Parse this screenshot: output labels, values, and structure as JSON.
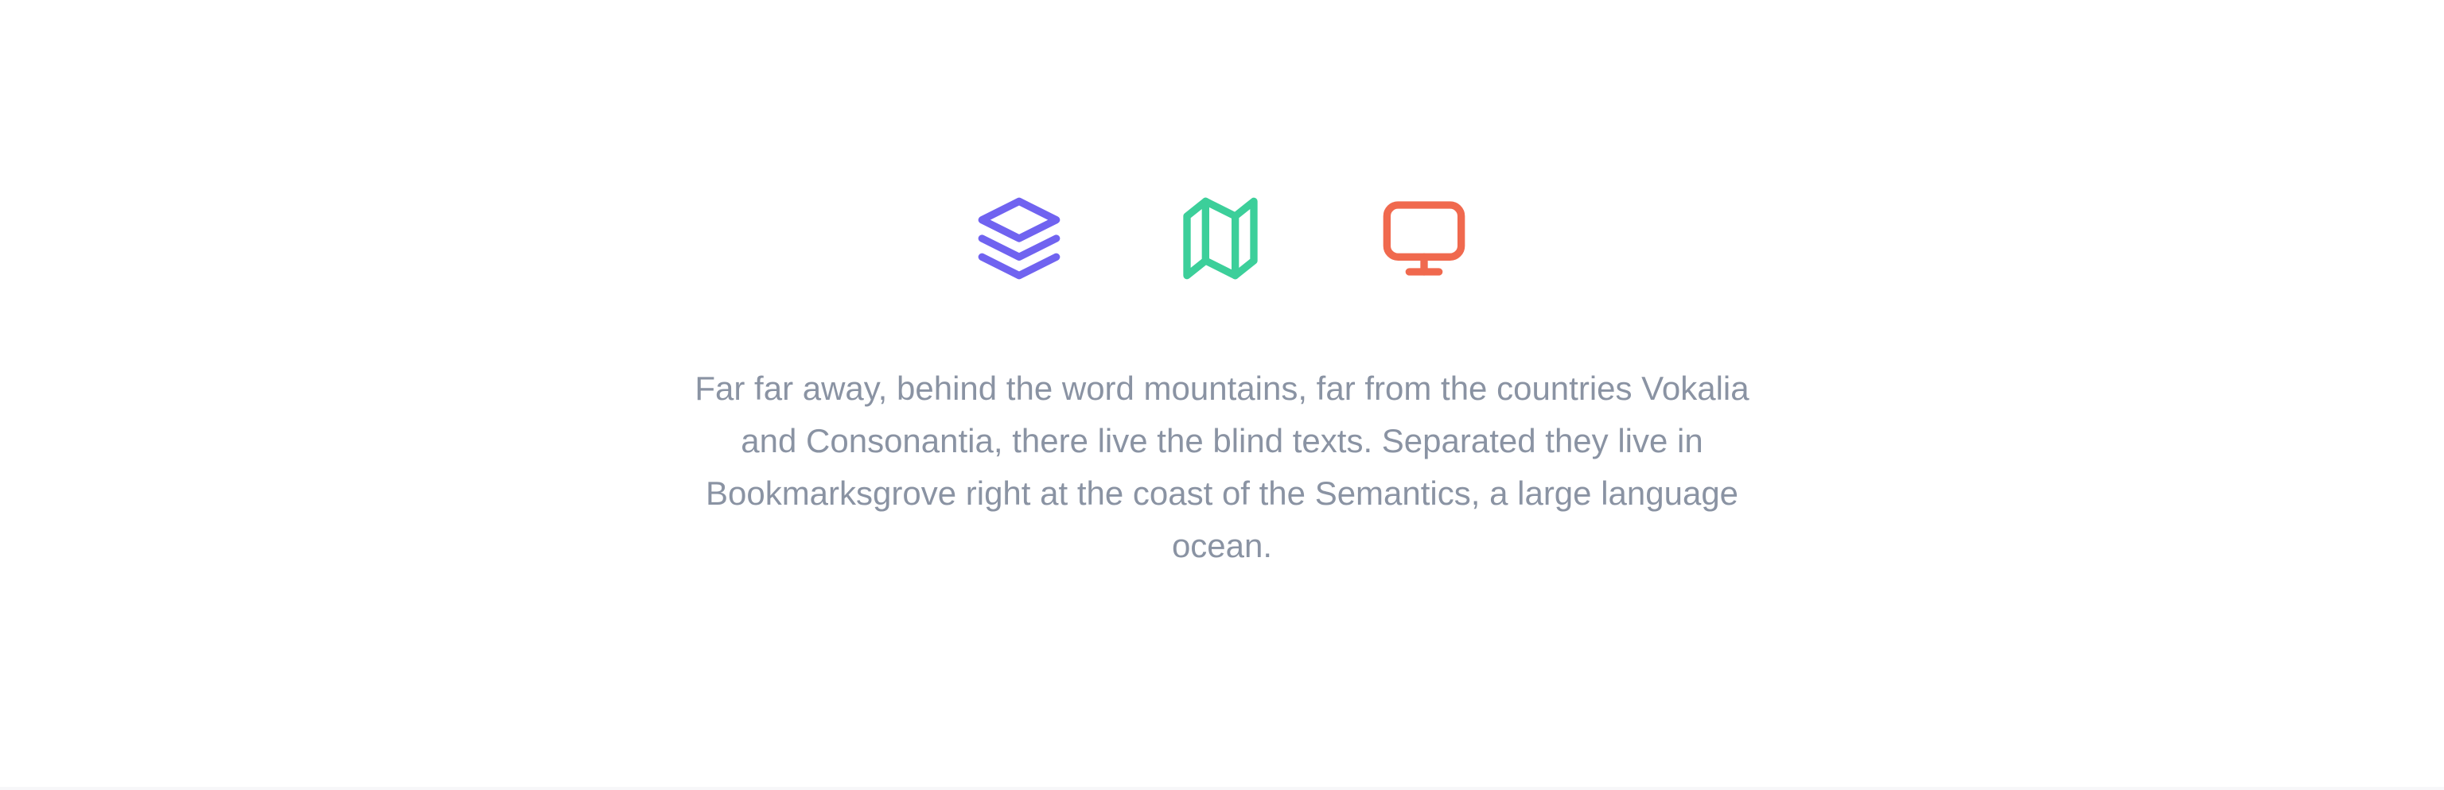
{
  "features": {
    "icons": [
      {
        "name": "layers-icon",
        "color": "#7063f0"
      },
      {
        "name": "map-icon",
        "color": "#3ccf9a"
      },
      {
        "name": "monitor-icon",
        "color": "#f0694e"
      }
    ],
    "description": "Far far away, behind the word mountains, far from the countries Vokalia and Consonantia, there live the blind texts. Separated they live in Bookmarksgrove right at the coast of the Semantics, a large language ocean."
  }
}
